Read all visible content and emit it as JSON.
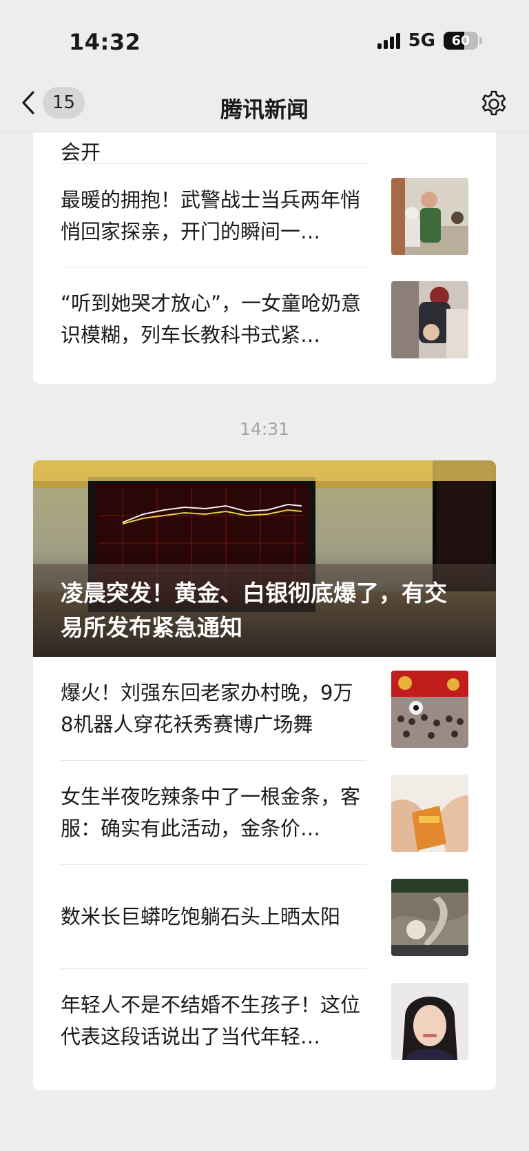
{
  "status_bar": {
    "time": "14:32",
    "network": "5G",
    "battery": "60",
    "battery_level": 0.6
  },
  "nav": {
    "back_count": "15",
    "title": "腾讯新闻"
  },
  "card1": {
    "partial_item": {
      "text": "会开"
    },
    "items": [
      {
        "title": "最暖的拥抱！武警战士当兵两年悄悄回家探亲，开门的瞬间一…"
      },
      {
        "title": "“听到她哭才放心”，一女童呛奶意识模糊，列车长教科书式紧…"
      }
    ]
  },
  "time_separator": "14:31",
  "card2": {
    "hero": {
      "title": "凌晨突发！黄金、白银彻底爆了，有交易所发布紧急通知"
    },
    "items": [
      {
        "title": "爆火！刘强东回老家办村晚，9万8机器人穿花袄秀赛博广场舞"
      },
      {
        "title": "女生半夜吃辣条中了一根金条，客服：确实有此活动，金条价…"
      },
      {
        "title": "数米长巨蟒吃饱躺石头上晒太阳"
      },
      {
        "title": "年轻人不是不结婚不生孩子！这位代表这段话说出了当代年轻…"
      }
    ]
  },
  "icons": {
    "back": "chevron-left-icon",
    "settings": "gear-icon"
  }
}
